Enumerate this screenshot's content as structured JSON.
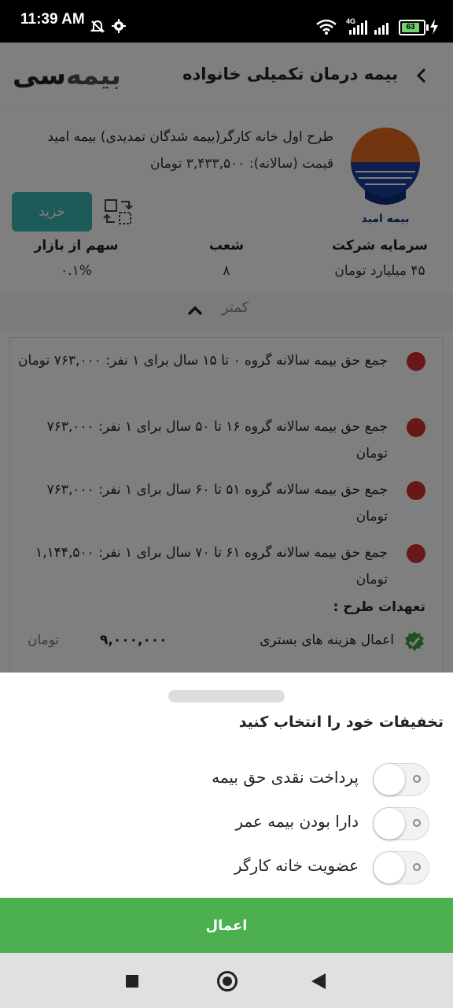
{
  "status_bar": {
    "time": "11:39 AM",
    "network": "4G",
    "battery": "63"
  },
  "app_bar": {
    "title": "بیمه درمان تکمیلی خانواده",
    "logo_text_left": "بیمه",
    "logo_text_right": "سی"
  },
  "plan": {
    "title": "طرح اول خانه کارگر(بیمه شدگان تمدیدی) بیمه امید",
    "price_label": "قیمت (سالانه):",
    "price_value": "۳,۴۳۳,۵۰۰ تومان",
    "buy_label": "خرید",
    "company_logo_text": "بیمه امید",
    "stats": [
      {
        "label": "سرمایه شرکت",
        "value": "۴۵ میلیارد تومان"
      },
      {
        "label": "شعب",
        "value": "۸"
      },
      {
        "label": "سهم از بازار",
        "value": "۰.۱%"
      }
    ],
    "collapse_label": "کمتر"
  },
  "premiums": [
    {
      "text": "جمع حق بیمه سالانه گروه ۰ تا ۱۵ سال برای ۱ نفر: ۷۶۳,۰۰۰ تومان"
    },
    {
      "text": "جمع حق بیمه سالانه گروه ۱۶ تا ۵۰ سال برای ۱ نفر: ۷۶۳,۰۰۰ تومان"
    },
    {
      "text": "جمع حق بیمه سالانه گروه ۵۱ تا ۶۰ سال برای ۱ نفر: ۷۶۳,۰۰۰ تومان"
    },
    {
      "text": "جمع حق بیمه سالانه گروه ۶۱ تا ۷۰ سال برای ۱ نفر: ۱,۱۴۴,۵۰۰ تومان"
    }
  ],
  "commitments": {
    "title": "تعهدات طرح :",
    "items": [
      {
        "name": "اعمال هزینه های بستری",
        "amount": "۹,۰۰۰,۰۰۰",
        "unit": "تومان"
      }
    ]
  },
  "discount_sheet": {
    "title": "تخفیفات خود را انتخاب کنید",
    "options": [
      {
        "label": "پرداخت نقدی حق بیمه",
        "checked": false
      },
      {
        "label": "دارا بودن بیمه عمر",
        "checked": false
      },
      {
        "label": "عضویت خانه کارگر",
        "checked": false
      }
    ],
    "apply_label": "اعمال"
  },
  "colors": {
    "accent_teal": "#3ab6b0",
    "apply_green": "#4caf50",
    "bullet_red": "#d32f2f",
    "check_green": "#43a047"
  }
}
